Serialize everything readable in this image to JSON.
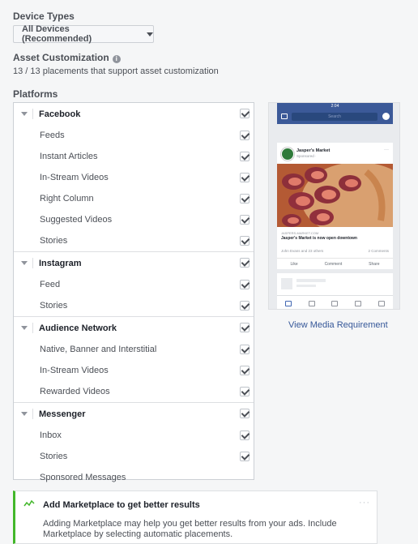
{
  "device_types": {
    "label": "Device Types",
    "selected": "All Devices (Recommended)"
  },
  "asset_customization": {
    "label": "Asset Customization",
    "info_icon": "info-icon",
    "summary": "13 / 13 placements that support asset customization"
  },
  "platforms": {
    "label": "Platforms",
    "sections": [
      {
        "name": "Facebook",
        "checked": true,
        "items": [
          {
            "label": "Feeds",
            "checked": true
          },
          {
            "label": "Instant Articles",
            "checked": true
          },
          {
            "label": "In-Stream Videos",
            "checked": true
          },
          {
            "label": "Right Column",
            "checked": true
          },
          {
            "label": "Suggested Videos",
            "checked": true
          },
          {
            "label": "Stories",
            "checked": true
          }
        ]
      },
      {
        "name": "Instagram",
        "checked": true,
        "items": [
          {
            "label": "Feed",
            "checked": true
          },
          {
            "label": "Stories",
            "checked": true
          }
        ]
      },
      {
        "name": "Audience Network",
        "checked": true,
        "items": [
          {
            "label": "Native, Banner and Interstitial",
            "checked": true
          },
          {
            "label": "In-Stream Videos",
            "checked": true
          },
          {
            "label": "Rewarded Videos",
            "checked": true
          }
        ]
      },
      {
        "name": "Messenger",
        "checked": true,
        "items": [
          {
            "label": "Inbox",
            "checked": true
          },
          {
            "label": "Stories",
            "checked": true
          },
          {
            "label": "Sponsored Messages",
            "checked": false
          }
        ]
      }
    ]
  },
  "preview": {
    "status_time": "2:04",
    "search_placeholder": "Search",
    "page_name": "Jasper's Market",
    "sponsored": "Sponsored · ",
    "url": "JASPERS-MARKET.COM",
    "headline": "Jasper's Market is now open downtown",
    "reactions": "John Evans and 23 others",
    "comments": "2 Comments",
    "actions": [
      "Like",
      "Comment",
      "Share"
    ]
  },
  "view_media_link": "View Media Requirement",
  "notice": {
    "title": "Add Marketplace to get better results",
    "more": "···",
    "body": "Adding Marketplace may help you get better results from your ads. Include Marketplace by selecting automatic placements."
  },
  "colors": {
    "facebook_blue": "#3b5998",
    "link": "#365899",
    "notice_accent": "#42b72a"
  }
}
